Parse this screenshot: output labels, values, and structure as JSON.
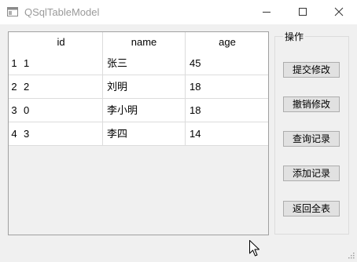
{
  "window": {
    "title": "QSqlTableModel"
  },
  "table": {
    "columns": [
      "id",
      "name",
      "age"
    ],
    "row_headers": [
      "1",
      "2",
      "3",
      "4"
    ],
    "rows": [
      [
        "1",
        "张三",
        "45"
      ],
      [
        "2",
        "刘明",
        "18"
      ],
      [
        "0",
        "李小明",
        "18"
      ],
      [
        "3",
        "李四",
        "14"
      ]
    ]
  },
  "panel": {
    "title": "操作",
    "buttons": {
      "submit": "提交修改",
      "revert": "撤销修改",
      "query": "查询记录",
      "add": "添加记录",
      "show_all": "返回全表"
    }
  },
  "icons": {
    "app": "app-window-icon",
    "minimize": "minimize-icon",
    "maximize": "maximize-icon",
    "close": "close-icon",
    "cursor": "mouse-pointer-icon",
    "grip": "size-grip-icon"
  }
}
